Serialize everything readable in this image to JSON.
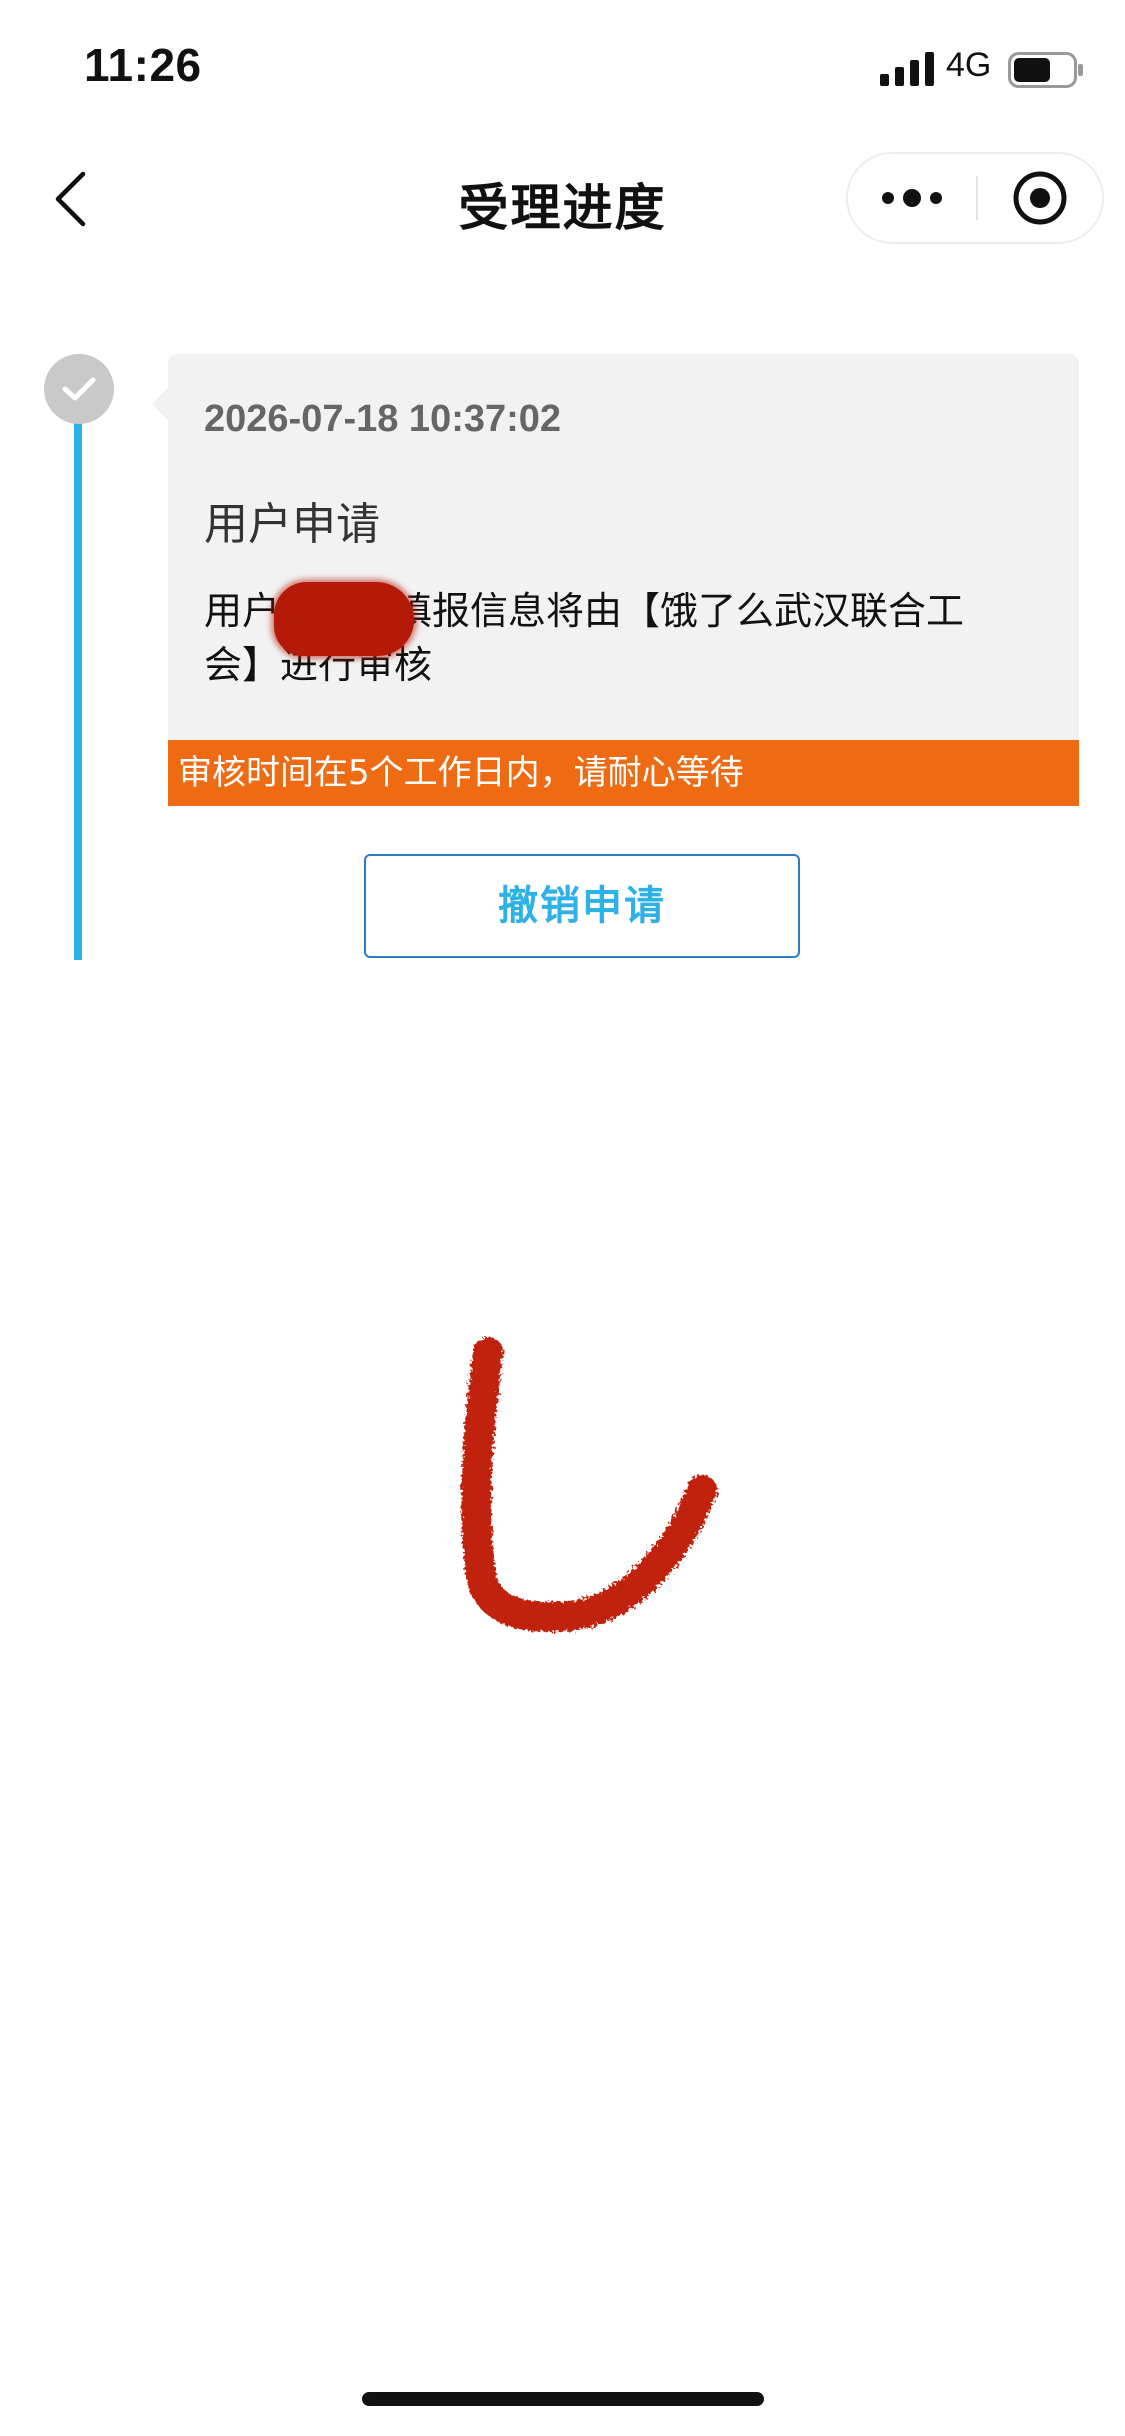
{
  "status_bar": {
    "time": "11:26",
    "network": "4G",
    "signal_icon": "signal-bars-icon",
    "battery_icon": "battery-icon",
    "battery_level": 0.55
  },
  "nav": {
    "title": "受理进度",
    "back_icon": "chevron-left-icon",
    "more_icon": "more-dots-icon",
    "close_icon": "target-circle-icon"
  },
  "timeline": {
    "node_icon": "check-icon",
    "line_color": "#2db1e6",
    "entries": [
      {
        "time": "2026-07-18 10:37:02",
        "title": "用户申请",
        "description_line1": "用户　　　填报信息将由【饿了么武汉联合工",
        "description_line2": "会】进行审核"
      }
    ]
  },
  "notice": {
    "text": "审核时间在5个工作日内，请耐心等待",
    "color": "#ee6b14"
  },
  "actions": {
    "revoke_label": "撤销申请"
  },
  "annotations": {
    "redaction_color": "#b51a08",
    "scribble": "red-hand-drawn-stroke"
  }
}
